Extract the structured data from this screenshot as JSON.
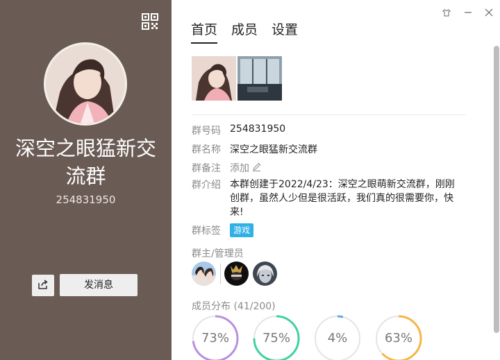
{
  "group": {
    "name": "深空之眼猛新交流群",
    "id": "254831950"
  },
  "actions": {
    "send_message": "发消息"
  },
  "tabs": [
    {
      "label": "首页",
      "active": true
    },
    {
      "label": "成员",
      "active": false
    },
    {
      "label": "设置",
      "active": false
    }
  ],
  "info": {
    "number_label": "群号码",
    "number_value": "254831950",
    "name_label": "群名称",
    "name_value": "深空之眼猛新交流群",
    "remark_label": "群备注",
    "remark_add": "添加",
    "intro_label": "群介绍",
    "intro_value": "本群创建于2022/4/23：深空之眼萌新交流群，刚刚创群，虽然人少但是很活跃，我们真的很需要你，快来!",
    "tag_label": "群标签",
    "tag_value": "游戏"
  },
  "admins_title": "群主/管理员",
  "distribution": {
    "title": "成员分布",
    "count": "(41/200)",
    "items": [
      {
        "value": 73,
        "label": "73%",
        "color": "#b98ee0"
      },
      {
        "value": 75,
        "label": "75%",
        "color": "#3fd1a0"
      },
      {
        "value": 4,
        "label": "4%",
        "color": "#5aa8f0"
      },
      {
        "value": 63,
        "label": "63%",
        "color": "#f6b545"
      }
    ]
  },
  "colors": {
    "left_panel": "#6b5b55",
    "tag": "#2fb0e6"
  },
  "icons": [
    "qr-code-icon",
    "skin-icon",
    "minimize-icon",
    "close-icon",
    "share-icon",
    "edit-icon"
  ]
}
